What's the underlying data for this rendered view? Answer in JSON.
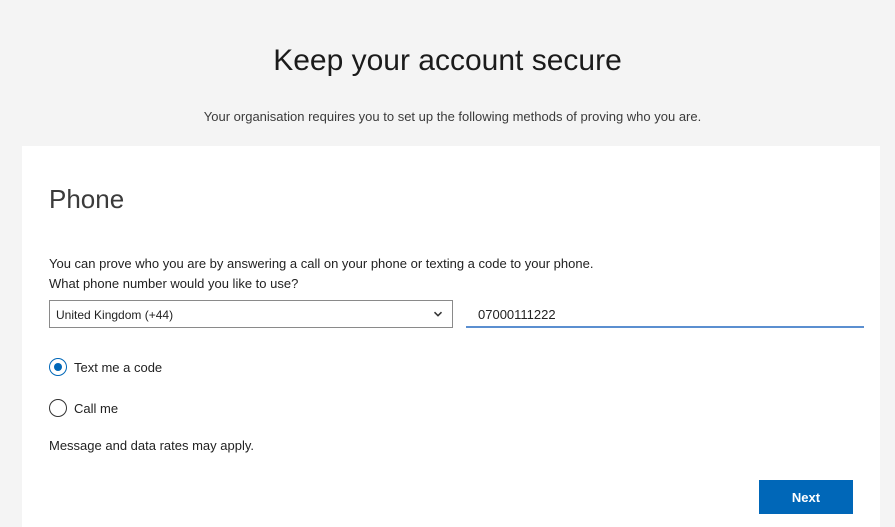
{
  "header": {
    "title": "Keep your account secure",
    "subtitle": "Your organisation requires you to set up the following methods of proving who you are."
  },
  "phone_section": {
    "title": "Phone",
    "description": "You can prove who you are by answering a call on your phone or texting a code to your phone.",
    "question": "What phone number would you like to use?",
    "country_select": {
      "value": "United Kingdom (+44)"
    },
    "phone_input": {
      "value": "07000111222"
    },
    "options": [
      {
        "label": "Text me a code",
        "selected": true
      },
      {
        "label": "Call me",
        "selected": false
      }
    ],
    "disclaimer": "Message and data rates may apply.",
    "next_label": "Next"
  },
  "colors": {
    "accent": "#0067b8",
    "input_underline": "#5b8fd0",
    "background": "#f4f4f4",
    "card": "#ffffff"
  },
  "icons": {
    "dropdown": "chevron-down-icon",
    "selected_radio": "radio-selected-icon",
    "unselected_radio": "radio-unselected-icon"
  }
}
